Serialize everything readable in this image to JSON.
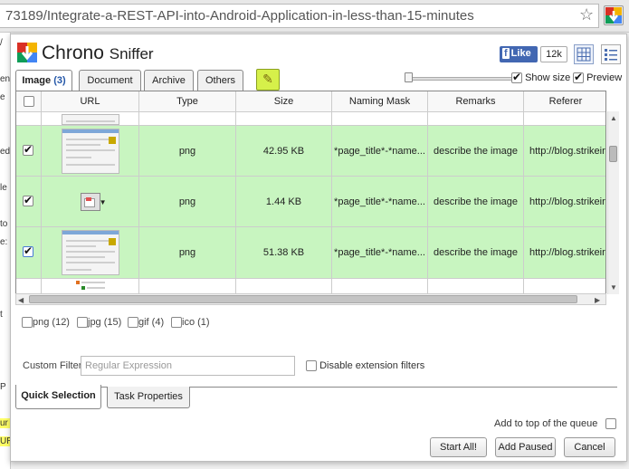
{
  "browser": {
    "url": "73189/Integrate-a-REST-API-into-Android-Application-in-less-than-15-minutes"
  },
  "background_page": {
    "lines": [
      "/",
      "",
      "ent",
      "e",
      "",
      "",
      "ed",
      "",
      "le",
      "",
      "to",
      "e:",
      "",
      "",
      "",
      "t",
      "",
      "",
      "",
      "P",
      "",
      "ur",
      "UR"
    ]
  },
  "app": {
    "title": "Chrono",
    "title_suffix": "Sniffer",
    "fb_like": "Like",
    "fb_count": "12k"
  },
  "tabs": [
    {
      "label": "Image",
      "count": "(3)",
      "active": true
    },
    {
      "label": "Document",
      "count": "",
      "active": false
    },
    {
      "label": "Archive",
      "count": "",
      "active": false
    },
    {
      "label": "Others",
      "count": "",
      "active": false
    }
  ],
  "options": {
    "show_size": "Show size",
    "show_size_checked": true,
    "preview": "Preview",
    "preview_checked": true,
    "thumbnail_size": 0
  },
  "columns": [
    "",
    "URL",
    "Type",
    "Size",
    "Naming Mask",
    "Remarks",
    "Referer"
  ],
  "rows": [
    {
      "checked": true,
      "type": "png",
      "size": "42.95 KB",
      "mask": "*page_title*-*name...",
      "remarks": "describe the image",
      "referer": "http://blog.strikeir...",
      "selected": true
    },
    {
      "checked": true,
      "type": "png",
      "size": "1.44 KB",
      "mask": "*page_title*-*name...",
      "remarks": "describe the image",
      "referer": "http://blog.strikeir...",
      "selected": true
    },
    {
      "checked": true,
      "type": "png",
      "size": "51.38 KB",
      "mask": "*page_title*-*name...",
      "remarks": "describe the image",
      "referer": "http://blog.strikeir...",
      "selected": true
    }
  ],
  "extensions": [
    {
      "label": "png (12)",
      "checked": false
    },
    {
      "label": "jpg (15)",
      "checked": false
    },
    {
      "label": "gif (4)",
      "checked": false
    },
    {
      "label": "ico (1)",
      "checked": false
    }
  ],
  "filter": {
    "label": "Custom Filter",
    "placeholder": "Regular Expression",
    "value": "",
    "disable_ext": "Disable extension filters"
  },
  "bottom_tabs": [
    {
      "label": "Quick Selection",
      "active": true
    },
    {
      "label": "Task Properties",
      "active": false
    }
  ],
  "footer": {
    "add_to_top": "Add to top of the queue",
    "start_all": "Start All!",
    "add_paused": "Add Paused",
    "cancel": "Cancel"
  }
}
